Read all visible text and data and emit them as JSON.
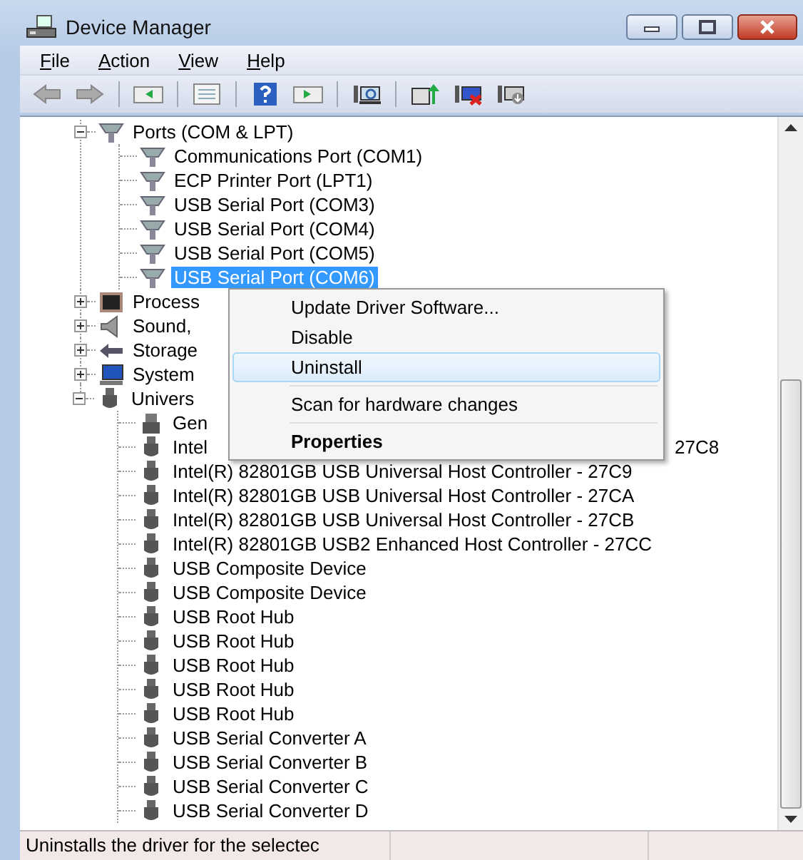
{
  "window": {
    "title": "Device Manager"
  },
  "menu_bar": [
    {
      "key": "F",
      "rest": "ile"
    },
    {
      "key": "A",
      "rest": "ction"
    },
    {
      "key": "V",
      "rest": "iew"
    },
    {
      "key": "H",
      "rest": "elp"
    }
  ],
  "tree": [
    {
      "label": "Ports (COM & LPT)",
      "kind": "ports",
      "expanded": true,
      "selected": false,
      "children": [
        {
          "label": "Communications Port (COM1)",
          "kind": "port",
          "selected": false
        },
        {
          "label": "ECP Printer Port (LPT1)",
          "kind": "port",
          "selected": false
        },
        {
          "label": "USB Serial Port (COM3)",
          "kind": "port",
          "selected": false
        },
        {
          "label": "USB Serial Port (COM4)",
          "kind": "port",
          "selected": false
        },
        {
          "label": "USB Serial Port (COM5)",
          "kind": "port",
          "selected": false
        },
        {
          "label": "USB Serial Port (COM6)",
          "kind": "port",
          "selected": true
        }
      ]
    },
    {
      "label": "Process",
      "kind": "processor",
      "expanded": false,
      "selected": false
    },
    {
      "label": "Sound,",
      "kind": "sound",
      "expanded": false,
      "selected": false
    },
    {
      "label": "Storage",
      "kind": "storage",
      "expanded": false,
      "selected": false
    },
    {
      "label": "System",
      "kind": "system",
      "expanded": false,
      "selected": false
    },
    {
      "label": "Univers",
      "kind": "usb",
      "expanded": true,
      "selected": false,
      "children": [
        {
          "label": "Gen",
          "kind": "device",
          "selected": false
        },
        {
          "label": "Intel",
          "tail": "27C8",
          "kind": "usb",
          "selected": false
        },
        {
          "label": "Intel(R) 82801GB USB Universal Host Controller - 27C9",
          "kind": "usb",
          "selected": false
        },
        {
          "label": "Intel(R) 82801GB USB Universal Host Controller - 27CA",
          "kind": "usb",
          "selected": false
        },
        {
          "label": "Intel(R) 82801GB USB Universal Host Controller - 27CB",
          "kind": "usb",
          "selected": false
        },
        {
          "label": "Intel(R) 82801GB USB2 Enhanced Host Controller - 27CC",
          "kind": "usb",
          "selected": false
        },
        {
          "label": "USB Composite Device",
          "kind": "usb",
          "selected": false
        },
        {
          "label": "USB Composite Device",
          "kind": "usb",
          "selected": false
        },
        {
          "label": "USB Root Hub",
          "kind": "usb",
          "selected": false
        },
        {
          "label": "USB Root Hub",
          "kind": "usb",
          "selected": false
        },
        {
          "label": "USB Root Hub",
          "kind": "usb",
          "selected": false
        },
        {
          "label": "USB Root Hub",
          "kind": "usb",
          "selected": false
        },
        {
          "label": "USB Root Hub",
          "kind": "usb",
          "selected": false
        },
        {
          "label": "USB Serial Converter A",
          "kind": "usb",
          "selected": false
        },
        {
          "label": "USB Serial Converter B",
          "kind": "usb",
          "selected": false
        },
        {
          "label": "USB Serial Converter C",
          "kind": "usb",
          "selected": false
        },
        {
          "label": "USB Serial Converter D",
          "kind": "usb",
          "selected": false
        }
      ]
    }
  ],
  "context_menu": [
    {
      "kind": "item",
      "label": "Update Driver Software...",
      "highlighted": false,
      "bold": false
    },
    {
      "kind": "item",
      "label": "Disable",
      "highlighted": false,
      "bold": false
    },
    {
      "kind": "item",
      "label": "Uninstall",
      "highlighted": true,
      "bold": false
    },
    {
      "kind": "separator"
    },
    {
      "kind": "item",
      "label": "Scan for hardware changes",
      "highlighted": false,
      "bold": false
    },
    {
      "kind": "separator"
    },
    {
      "kind": "item",
      "label": "Properties",
      "highlighted": false,
      "bold": true
    }
  ],
  "status_bar": {
    "text": "Uninstalls the driver for the selectec"
  }
}
